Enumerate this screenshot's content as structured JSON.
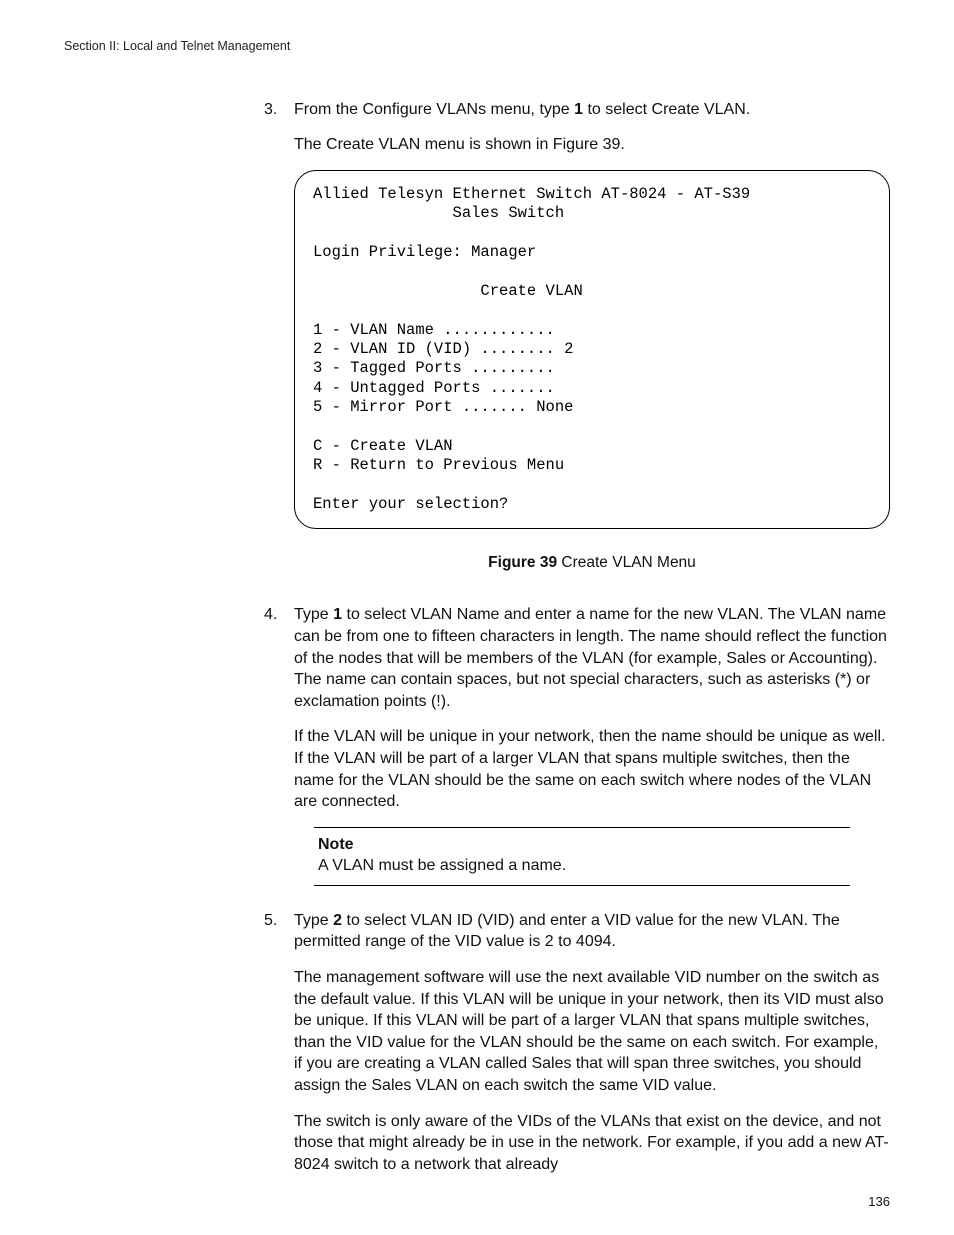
{
  "header": {
    "section": "Section II: Local and Telnet Management"
  },
  "steps": {
    "step3": {
      "num": "3.",
      "line1_a": "From the Configure VLANs menu, type ",
      "line1_bold": "1",
      "line1_b": " to select Create VLAN.",
      "line2": "The Create VLAN menu is shown in Figure 39."
    },
    "step4": {
      "num": "4.",
      "p1_a": "Type ",
      "p1_bold": "1",
      "p1_b": " to select VLAN Name and enter a name for the new VLAN. The VLAN name can be from one to fifteen characters in length. The name should reflect the function of the nodes that will be members of the VLAN (for example, Sales or Accounting). The name can contain spaces, but not special characters, such as asterisks (*) or exclamation points (!).",
      "p2": "If the VLAN will be unique in your network, then the name should be unique as well. If the VLAN will be part of a larger VLAN that spans multiple switches, then the name for the VLAN should be the same on each switch where nodes of the VLAN are connected."
    },
    "step5": {
      "num": "5.",
      "p1_a": "Type ",
      "p1_bold": "2",
      "p1_b": " to select VLAN ID (VID) and enter a VID value for the new VLAN. The permitted range of the VID value is 2 to 4094.",
      "p2": "The management software will use the next available VID number on the switch as the default value. If this VLAN will be unique in your network, then its VID must also be unique. If this VLAN will be part of a larger VLAN that spans multiple switches, than the VID value for the VLAN should be the same on each switch. For example, if you are creating a VLAN called Sales that will span three switches, you should assign the Sales VLAN on each switch the same VID value.",
      "p3": "The switch is only aware of the VIDs of the VLANs that exist on the device, and not those that might already be in use in the network. For example, if you add a new AT-8024 switch to a network that already"
    }
  },
  "terminal": {
    "l1": "Allied Telesyn Ethernet Switch AT-8024 - AT-S39",
    "l2": "               Sales Switch",
    "l3": "Login Privilege: Manager",
    "l4": "                  Create VLAN",
    "l5": "1 - VLAN Name ............",
    "l6": "2 - VLAN ID (VID) ........ 2",
    "l7": "3 - Tagged Ports .........",
    "l8": "4 - Untagged Ports .......",
    "l9": "5 - Mirror Port ....... None",
    "l10": "C - Create VLAN",
    "l11": "R - Return to Previous Menu",
    "l12": "Enter your selection?"
  },
  "figure": {
    "label_bold": "Figure 39",
    "label_rest": "  Create VLAN Menu"
  },
  "note": {
    "label": "Note",
    "body": "A VLAN must be assigned a name."
  },
  "footer": {
    "page": "136"
  }
}
